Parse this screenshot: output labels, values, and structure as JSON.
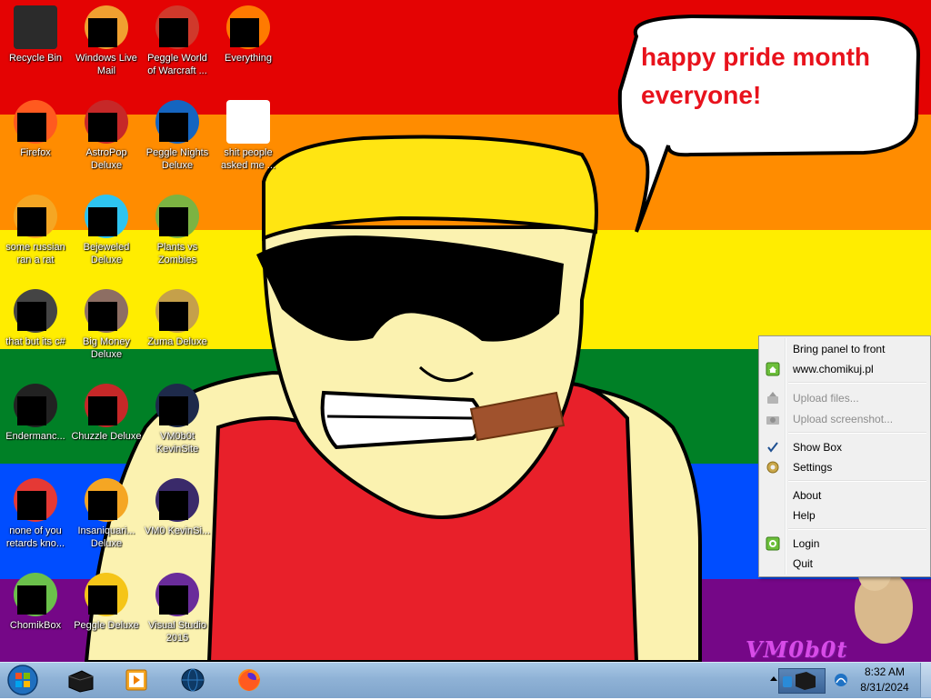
{
  "desktop": {
    "speech_bubble_text": "happy pride month everyone!",
    "watermark": "VM0b0t",
    "stripe_colors": [
      "#e40303",
      "#ff8c00",
      "#ffed00",
      "#008026",
      "#004dff",
      "#750787"
    ],
    "icons": [
      {
        "label": "Recycle Bin",
        "icon": "recycle-bin-icon",
        "censored": false
      },
      {
        "label": "Windows Live Mail",
        "icon": "windows-live-mail-icon",
        "censored": true
      },
      {
        "label": "Peggle World of Warcraft ...",
        "icon": "peggle-wow-icon",
        "censored": true
      },
      {
        "label": "Everything",
        "icon": "everything-search-icon",
        "censored": true
      },
      {
        "label": "Firefox",
        "icon": "firefox-icon",
        "censored": true
      },
      {
        "label": "AstroPop Deluxe",
        "icon": "astropop-icon",
        "censored": true
      },
      {
        "label": "Peggle Nights Deluxe",
        "icon": "peggle-nights-icon",
        "censored": true
      },
      {
        "label": "shit people asked me ...",
        "icon": "folder-icon",
        "censored": false
      },
      {
        "label": "some russian ran a rat",
        "icon": "file-icon",
        "censored": true
      },
      {
        "label": "Bejeweled Deluxe",
        "icon": "bejeweled-icon",
        "censored": true
      },
      {
        "label": "Plants vs Zombies",
        "icon": "plants-vs-zombies-icon",
        "censored": true
      },
      {
        "label": "that but its c#",
        "icon": "files-icon",
        "censored": true
      },
      {
        "label": "Big Money Deluxe",
        "icon": "big-money-icon",
        "censored": true
      },
      {
        "label": "Zuma Deluxe",
        "icon": "zuma-icon",
        "censored": true
      },
      {
        "label": "Endermanc...",
        "icon": "terminal-icon",
        "censored": true
      },
      {
        "label": "Chuzzle Deluxe",
        "icon": "chuzzle-icon",
        "censored": true
      },
      {
        "label": "VM0b0t KevinSite",
        "icon": "vm-icon",
        "censored": true
      },
      {
        "label": "none of you retards kno...",
        "icon": "game-icon",
        "censored": true
      },
      {
        "label": "Insaniquari... Deluxe",
        "icon": "insaniquarium-icon",
        "censored": true
      },
      {
        "label": "VM0 KevinSi...",
        "icon": "vm-icon",
        "censored": true
      },
      {
        "label": "ChomikBox",
        "icon": "chomikbox-icon",
        "censored": true
      },
      {
        "label": "Peggle Deluxe",
        "icon": "peggle-icon",
        "censored": true
      },
      {
        "label": "Visual Studio 2015",
        "icon": "visual-studio-icon",
        "censored": true
      }
    ]
  },
  "context_menu": {
    "items": [
      {
        "label": "Bring panel to front",
        "icon": "",
        "enabled": true,
        "checked": false
      },
      {
        "label": "www.chomikuj.pl",
        "icon": "home-icon",
        "enabled": true,
        "checked": false
      },
      {
        "label": "Upload files...",
        "icon": "upload-icon",
        "enabled": false,
        "checked": false
      },
      {
        "label": "Upload screenshot...",
        "icon": "upload-icon",
        "enabled": false,
        "checked": false
      },
      {
        "label": "Show Box",
        "icon": "checkmark-icon",
        "enabled": true,
        "checked": true
      },
      {
        "label": "Settings",
        "icon": "gear-icon",
        "enabled": true,
        "checked": false
      },
      {
        "label": "About",
        "icon": "",
        "enabled": true,
        "checked": false
      },
      {
        "label": "Help",
        "icon": "",
        "enabled": true,
        "checked": false
      },
      {
        "label": "Login",
        "icon": "login-icon",
        "enabled": true,
        "checked": false
      },
      {
        "label": "Quit",
        "icon": "",
        "enabled": true,
        "checked": false
      }
    ]
  },
  "taskbar": {
    "start_icon": "windows-start-icon",
    "pinned": [
      {
        "name": "box-app-icon"
      },
      {
        "name": "media-player-icon"
      },
      {
        "name": "globe-icon"
      },
      {
        "name": "firefox-icon"
      }
    ],
    "tray_icons": [
      "show-hidden-icons-icon",
      "chomikbox-tray-icon",
      "network-icon"
    ],
    "time": "8:32 AM",
    "date": "8/31/2024"
  }
}
